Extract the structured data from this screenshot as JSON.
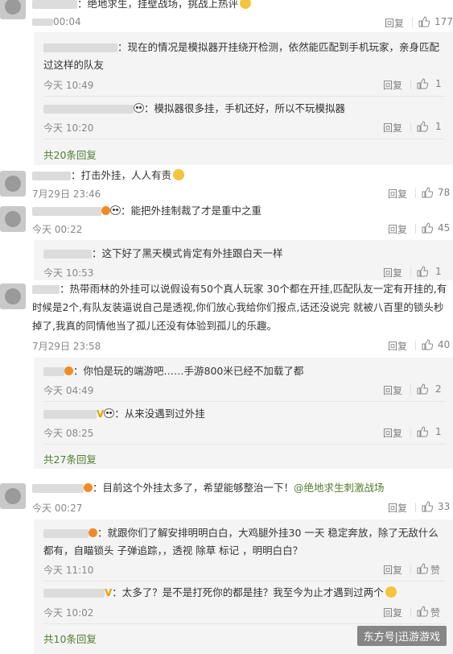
{
  "reply_label": "回复",
  "like_label": "赞",
  "comments": [
    {
      "text": "：绝地求生，挂壁战场，挑战上热评",
      "time": "00:04",
      "likes": "177"
    },
    {
      "text": "：打击外挂，人人有责",
      "time": "7月29日 23:46",
      "likes": "78"
    },
    {
      "text": "：能把外挂制裁了才是重中之重",
      "time": "今天 00:22",
      "likes": "45"
    },
    {
      "text": "：热带雨林的外挂可以说假设有50个真人玩家 30个都在开挂,匹配队友一定有开挂的,有时候是2个,有队友装逼说自己是透视,你们放心我给你们报点,话还没说完 就被八百里的锁头秒掉了,我真的同情他当了孤儿还没有体验到孤儿的乐趣。",
      "time": "7月29日 23:58",
      "likes": "40"
    },
    {
      "text": "：目前这个外挂太多了，希望能够整治一下！",
      "link": "@绝地求生刺激战场",
      "time": "今天 00:27",
      "likes": "33"
    }
  ],
  "replies": [
    {
      "text": "：现在的情况是模拟器开挂绕开检测，依然能匹配到手机玩家，亲身匹配过这样的队友",
      "time": "今天 10:49",
      "likes": "1"
    },
    {
      "text": "：模拟器很多挂，手机还好，所以不玩模拟器",
      "time": "今天 10:20",
      "likes": "1"
    },
    {
      "text": "：这下好了黑天模式肯定有外挂跟白天一样",
      "time": "今天 10:53",
      "likes": "1"
    },
    {
      "text": "：你怕是玩的端游吧……手游800米已经不加载了都",
      "time": "今天 04:49",
      "likes": "2"
    },
    {
      "text": "：从来没遇到过外挂",
      "time": "今天 08:25",
      "likes": "1"
    },
    {
      "text": "：就跟你们了解安排明明白白，大鸡腿外挂30 一天  稳定奔放，除了无敌什么都有，自瞄锁头 子弹追踪，，透视  除草  标记  ，明明白白？",
      "time": "今天 11:10"
    },
    {
      "text": "：太多了？是不是打死你的都是挂？我至今为止才遇到过两个",
      "time": "今天 10:02"
    }
  ],
  "more_replies": [
    "共20条回复",
    "共27条回复",
    "共10条回复"
  ],
  "watermark": "东方号|迅游游戏"
}
